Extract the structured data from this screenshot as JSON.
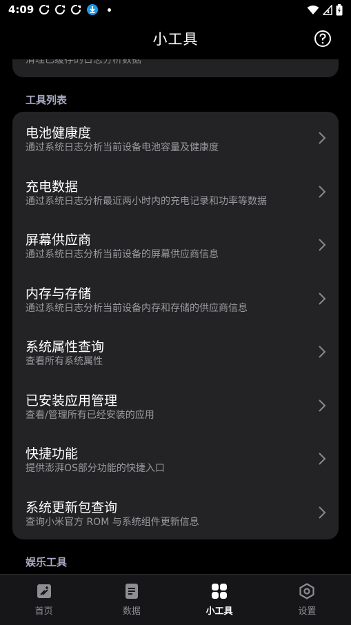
{
  "status_bar": {
    "time": "4:09"
  },
  "header": {
    "title": "小工具"
  },
  "top_card": {
    "partial_text": "清理已缓存的日志分析数据"
  },
  "tools_section": {
    "title": "工具列表",
    "items": [
      {
        "title": "电池健康度",
        "desc": "通过系统日志分析当前设备电池容量及健康度"
      },
      {
        "title": "充电数据",
        "desc": "通过系统日志分析最近两小时内的充电记录和功率等数据"
      },
      {
        "title": "屏幕供应商",
        "desc": "通过系统日志分析当前设备的屏幕供应商信息"
      },
      {
        "title": "内存与存储",
        "desc": "通过系统日志分析当前设备内存和存储的供应商信息"
      },
      {
        "title": "系统属性查询",
        "desc": "查看所有系统属性"
      },
      {
        "title": "已安装应用管理",
        "desc": "查看/管理所有已经安装的应用"
      },
      {
        "title": "快捷功能",
        "desc": "提供澎湃OS部分功能的快捷入口"
      },
      {
        "title": "系统更新包查询",
        "desc": "查询小米官方 ROM 与系统组件更新信息"
      }
    ]
  },
  "entertainment_section": {
    "title": "娱乐工具"
  },
  "bottom_nav": {
    "items": [
      {
        "label": "首页",
        "icon": "home-icon"
      },
      {
        "label": "数据",
        "icon": "document-icon"
      },
      {
        "label": "小工具",
        "icon": "grid-icon"
      },
      {
        "label": "设置",
        "icon": "settings-icon"
      }
    ],
    "active_index": 2
  },
  "colors": {
    "background": "#000000",
    "card": "#232325",
    "section_title": "#a9a9c4",
    "secondary_text": "#9a9a9e"
  }
}
